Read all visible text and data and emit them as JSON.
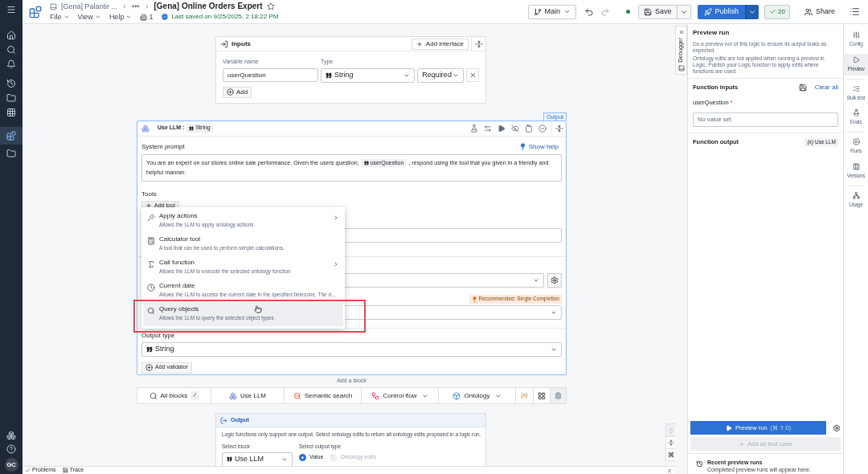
{
  "app_bar": {
    "breadcrumb": "[Gena] Palantir ...",
    "more": "•••",
    "title": "[Gena] Online Orders Expert",
    "starred": false,
    "menus": [
      "File",
      "View",
      "Help"
    ],
    "resource_count": "1",
    "save_status": "Last saved on 9/25/2025, 2:18:22 PM",
    "branch": "Main",
    "save": "Save",
    "publish": "Publish",
    "checks": "20",
    "share": "Share"
  },
  "left_rail": {
    "user_initials": "GC"
  },
  "inputs": {
    "title": "Inputs",
    "add_interface": "Add interface",
    "variable_label": "Variable name",
    "type_label": "Type",
    "variables": [
      {
        "name": "userQuestion",
        "type": "String",
        "requirement": "Required"
      }
    ],
    "add": "Add"
  },
  "llm_block": {
    "output_tag": "Output",
    "title": "Use LLM :",
    "type": "String",
    "system_prompt_label": "System prompt",
    "show_help": "Show help",
    "prompt_before": "You are an expert on our stores online sale performance. Given the users question,",
    "prompt_variable": "userQuestion",
    "prompt_after": ", respond using the tool that you given in a friendly and",
    "prompt_continuation": "helpful manner.",
    "tools_label": "Tools",
    "add_tool": "Add tool",
    "recommendation": "Recommended: Single Completion",
    "output_type_label": "Output type",
    "output_type": "String",
    "add_validator": "Add validator"
  },
  "tool_menu": {
    "items": [
      {
        "kind": "actions",
        "label": "Apply actions",
        "description": "Allows the LLM to apply ontology actions",
        "submenu": true,
        "selected": false,
        "highlighted": false
      },
      {
        "kind": "calculator",
        "label": "Calculator tool",
        "description": "A tool that can be used to perform simple calculations.",
        "submenu": false,
        "selected": false,
        "highlighted": false
      },
      {
        "kind": "function",
        "label": "Call function",
        "description": "Allows the LLM to execute the selected ontology function",
        "submenu": true,
        "selected": false,
        "highlighted": false
      },
      {
        "kind": "date",
        "label": "Current date",
        "description": "Allows the LLM to access the current date in the specified timezone. The d...",
        "submenu": false,
        "selected": false,
        "highlighted": false
      },
      {
        "kind": "query",
        "label": "Query objects",
        "description": "Allows the LLM to query the selected object types",
        "submenu": false,
        "selected": true,
        "highlighted": true
      }
    ]
  },
  "add_block": {
    "label": "Add a block",
    "options": [
      {
        "kind": "search",
        "label": "All blocks",
        "shortcut": "/",
        "dropdown": false
      },
      {
        "kind": "llm",
        "label": "Use LLM",
        "dropdown": false
      },
      {
        "kind": "semantic",
        "label": "Semantic search",
        "dropdown": false
      },
      {
        "kind": "flow",
        "label": "Control flow",
        "dropdown": true
      },
      {
        "kind": "ontology",
        "label": "Ontology",
        "dropdown": true
      }
    ],
    "variable_symbol": "(x)"
  },
  "output": {
    "title": "Output",
    "note": "Logic functions only support one output. Select ontology edits to return all ontology edits proposed in a logic run.",
    "select_block_label": "Select block",
    "select_block": "Use LLM",
    "output_type_label": "Select output type",
    "options": [
      {
        "label": "Value",
        "selected": true
      },
      {
        "label": "Ontology edits",
        "selected": false
      }
    ]
  },
  "debugger": {
    "label": "Debugger"
  },
  "preview": {
    "title": "Preview run",
    "description": "Do a preview run of this logic to ensure its output looks as expected.",
    "note": "Ontology edits are not applied when running a preview in Logic. Publish your Logic function to apply edits where functions are used.",
    "inputs_title": "Function inputs",
    "clear_all": "Clear all",
    "inputs": [
      {
        "name": "userQuestion",
        "required": true,
        "required_mark": "*",
        "placeholder": "No value set"
      }
    ],
    "output_title": "Function output",
    "output_symbol": "(x)",
    "output_source": "Use LLM",
    "run": "Preview run",
    "run_shortcut": "(⌘ ⇧ D)",
    "add_test": "Add as test case",
    "recent_title": "Recent preview runs",
    "recent_note": "Completed preview runs will appear here."
  },
  "right_rail": [
    {
      "kind": "config",
      "label": "Config",
      "selected": false
    },
    {
      "kind": "preview",
      "label": "Preview",
      "selected": true
    },
    {
      "kind": "bulk",
      "label": "Bulk test",
      "selected": false
    },
    {
      "kind": "evals",
      "label": "Evals",
      "selected": false
    },
    {
      "kind": "runs",
      "label": "Runs",
      "selected": false
    },
    {
      "kind": "versions",
      "label": "Versions",
      "selected": false
    },
    {
      "kind": "usage",
      "label": "Usage",
      "selected": false
    }
  ],
  "bottom_bar": [
    {
      "kind": "problems",
      "label": "Problems"
    },
    {
      "kind": "trace",
      "label": "Trace"
    }
  ]
}
